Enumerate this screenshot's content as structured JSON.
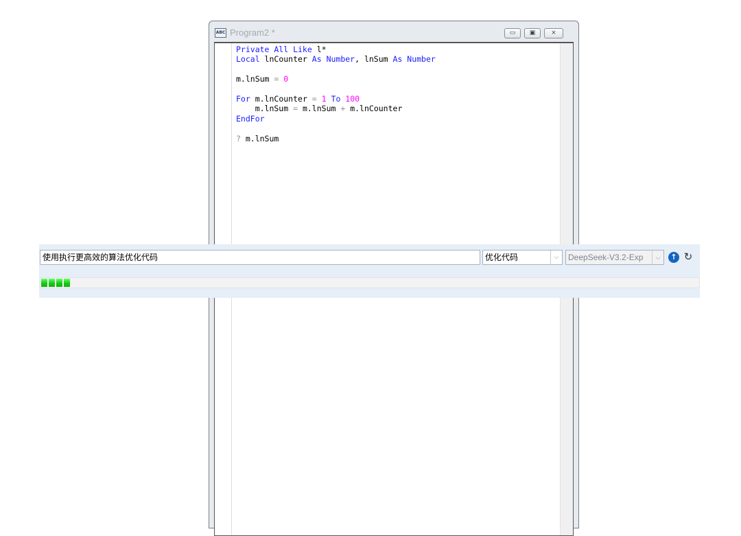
{
  "window": {
    "title": "Program2 *",
    "icon_text": "ABC"
  },
  "controls": {
    "minimize": "▭",
    "maximize": "▣",
    "close": "⨯"
  },
  "code_lines": [
    [
      {
        "t": "Private All Like ",
        "c": "kw"
      },
      {
        "t": "l*",
        "c": ""
      }
    ],
    [
      {
        "t": "Local ",
        "c": "kw"
      },
      {
        "t": "lnCounter ",
        "c": ""
      },
      {
        "t": "As Number",
        "c": "kw"
      },
      {
        "t": ", lnSum ",
        "c": ""
      },
      {
        "t": "As Number",
        "c": "kw"
      }
    ],
    [],
    [
      {
        "t": "m.lnSum ",
        "c": ""
      },
      {
        "t": "= ",
        "c": "op"
      },
      {
        "t": "0",
        "c": "num"
      }
    ],
    [],
    [
      {
        "t": "For ",
        "c": "kw"
      },
      {
        "t": "m.lnCounter ",
        "c": ""
      },
      {
        "t": "= ",
        "c": "op"
      },
      {
        "t": "1 ",
        "c": "num"
      },
      {
        "t": "To ",
        "c": "kw"
      },
      {
        "t": "100",
        "c": "num"
      }
    ],
    [
      {
        "t": "    m.lnSum ",
        "c": ""
      },
      {
        "t": "= ",
        "c": "op"
      },
      {
        "t": "m.lnSum ",
        "c": ""
      },
      {
        "t": "+ ",
        "c": "op"
      },
      {
        "t": "m.lnCounter",
        "c": ""
      }
    ],
    [
      {
        "t": "EndFor",
        "c": "kw"
      }
    ],
    [],
    [
      {
        "t": "? ",
        "c": "op"
      },
      {
        "t": "m.lnSum",
        "c": ""
      }
    ]
  ],
  "ai_bar": {
    "prompt_value": "使用执行更高效的算法优化代码",
    "action_value": "优化代码",
    "model_value": "DeepSeek-V3.2-Exp",
    "dropdown_arrow": "⌵",
    "run_glyph": "↑",
    "refresh_glyph": "↻",
    "progress_fraction": 0.05
  },
  "colors": {
    "keyword": "#1a1aff",
    "number": "#ff00ff",
    "operator": "#909090",
    "progress": "#18c918"
  }
}
